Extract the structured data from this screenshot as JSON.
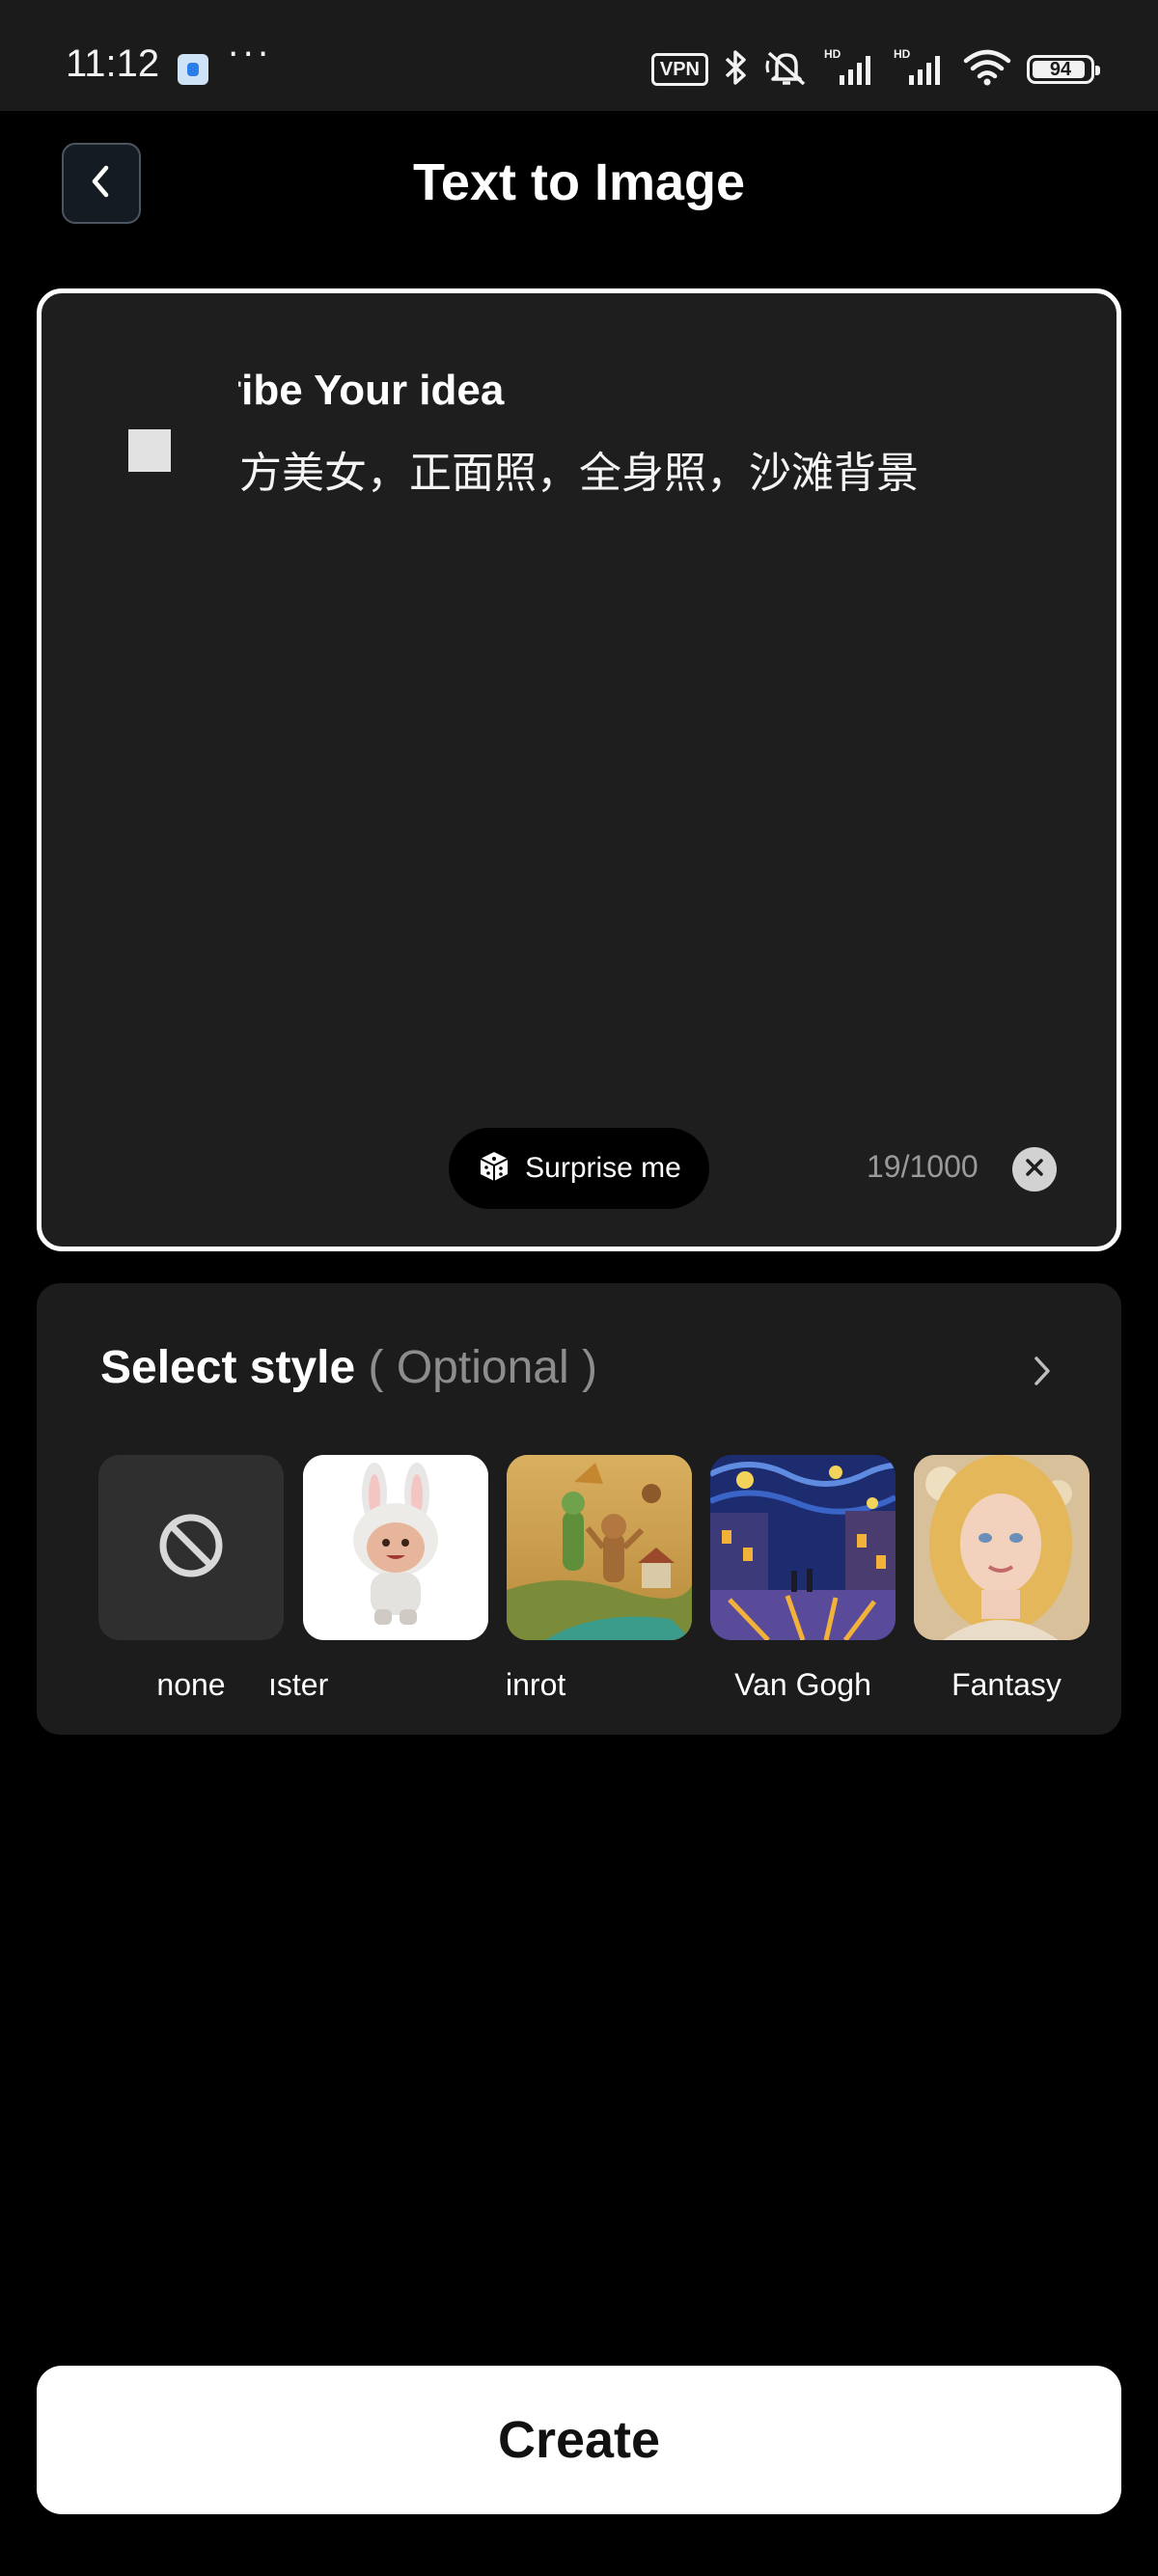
{
  "status_bar": {
    "time": "11:12",
    "overflow": "···",
    "vpn_label": "VPN",
    "battery_level": 94,
    "battery_label": "94",
    "icons": [
      "app-icon",
      "vpn-icon",
      "bluetooth-icon",
      "mute-icon",
      "hd-signal-icon",
      "hd-signal-icon",
      "wifi-icon",
      "battery-icon"
    ]
  },
  "header": {
    "title": "Text to Image",
    "back_icon": "chevron-left-icon"
  },
  "prompt": {
    "heading": "ribe Your idea",
    "text": "方美女，正面照，全身照，沙滩背景",
    "surprise_label": "Surprise me",
    "counter": "19/1000",
    "counter_sep": "|"
  },
  "style": {
    "title": "Select style",
    "optional": "( Optional )",
    "items": [
      {
        "label": "none"
      },
      {
        "label": "ıster"
      },
      {
        "label": "inrot"
      },
      {
        "label": "Van Gogh"
      },
      {
        "label": "Fantasy"
      }
    ]
  },
  "create": {
    "label": "Create"
  },
  "colors": {
    "background": "#000000",
    "card": "#1e1e1e",
    "accent": "#ffffff",
    "muted": "#8d8d8d"
  }
}
